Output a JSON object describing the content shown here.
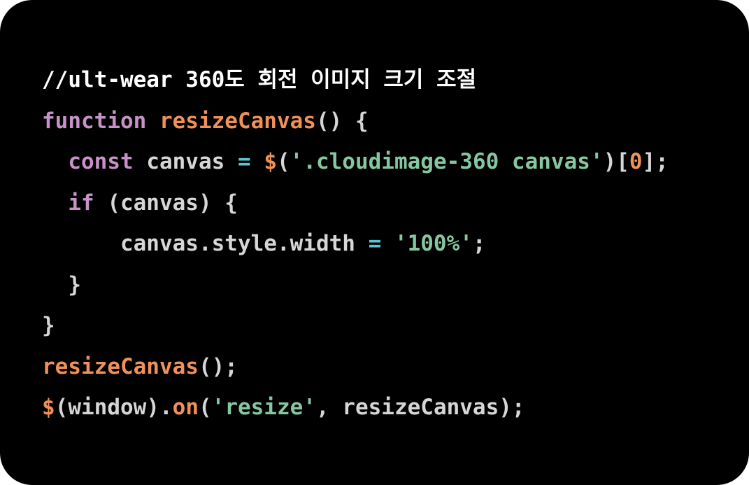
{
  "colors": {
    "background": "#000000",
    "comment": "#ffffff",
    "keyword": "#c792c7",
    "function": "#f0915a",
    "string": "#86c6a0",
    "operator": "#5fc3d0",
    "number": "#f0915a",
    "plain": "#d6d6d6"
  },
  "code_lines": [
    {
      "indent": "",
      "tokens": [
        {
          "text": "//ult-wear 360도 회전 이미지 크기 조절",
          "type": "comment"
        }
      ]
    },
    {
      "indent": "",
      "tokens": [
        {
          "text": "function",
          "type": "keyword"
        },
        {
          "text": " ",
          "type": "plain"
        },
        {
          "text": "resizeCanvas",
          "type": "function"
        },
        {
          "text": "() {",
          "type": "plain"
        }
      ]
    },
    {
      "indent": "  ",
      "tokens": [
        {
          "text": "const",
          "type": "keyword"
        },
        {
          "text": " canvas ",
          "type": "plain"
        },
        {
          "text": "=",
          "type": "operator"
        },
        {
          "text": " ",
          "type": "plain"
        },
        {
          "text": "$",
          "type": "function"
        },
        {
          "text": "(",
          "type": "plain"
        },
        {
          "text": "'.cloudimage-360 canvas'",
          "type": "string"
        },
        {
          "text": ")[",
          "type": "plain"
        },
        {
          "text": "0",
          "type": "number"
        },
        {
          "text": "];",
          "type": "plain"
        }
      ]
    },
    {
      "indent": "  ",
      "tokens": [
        {
          "text": "if",
          "type": "keyword"
        },
        {
          "text": " (canvas) {",
          "type": "plain"
        }
      ]
    },
    {
      "indent": "      ",
      "tokens": [
        {
          "text": "canvas.style.width ",
          "type": "plain"
        },
        {
          "text": "=",
          "type": "operator"
        },
        {
          "text": " ",
          "type": "plain"
        },
        {
          "text": "'100%'",
          "type": "string"
        },
        {
          "text": ";",
          "type": "plain"
        }
      ]
    },
    {
      "indent": "  ",
      "tokens": [
        {
          "text": "}",
          "type": "plain"
        }
      ]
    },
    {
      "indent": "",
      "tokens": [
        {
          "text": "}",
          "type": "plain"
        }
      ]
    },
    {
      "indent": "",
      "tokens": [
        {
          "text": "resizeCanvas",
          "type": "function"
        },
        {
          "text": "();",
          "type": "plain"
        }
      ]
    },
    {
      "indent": "",
      "tokens": [
        {
          "text": "$",
          "type": "function"
        },
        {
          "text": "(window).",
          "type": "plain"
        },
        {
          "text": "on",
          "type": "function"
        },
        {
          "text": "(",
          "type": "plain"
        },
        {
          "text": "'resize'",
          "type": "string"
        },
        {
          "text": ", resizeCanvas);",
          "type": "plain"
        }
      ]
    }
  ]
}
